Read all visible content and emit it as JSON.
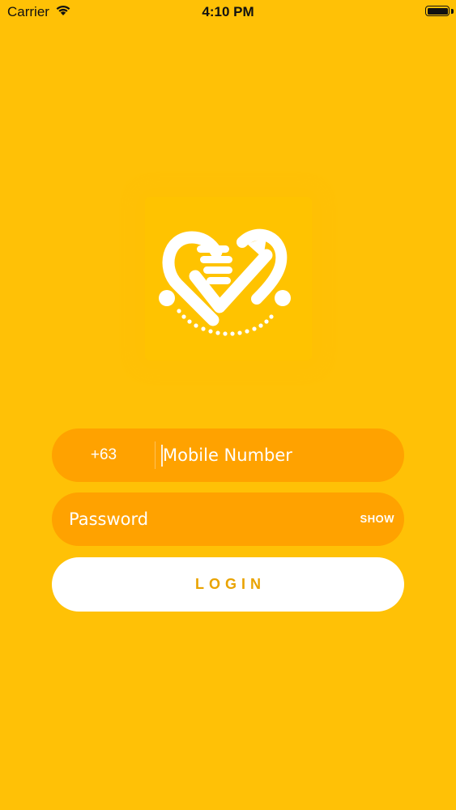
{
  "status_bar": {
    "carrier": "Carrier",
    "time": "4:10 PM"
  },
  "logo": {
    "icon": "heart-hand-arrow-logo"
  },
  "login_form": {
    "country_code": "+63",
    "mobile_placeholder": "Mobile Number",
    "password_placeholder": "Password",
    "show_label": "SHOW",
    "login_label": "LOGIN"
  },
  "colors": {
    "background": "#FFC106",
    "input_fill": "#FFA200",
    "button_fill": "#FFFFFF",
    "button_text": "#E9A300"
  }
}
